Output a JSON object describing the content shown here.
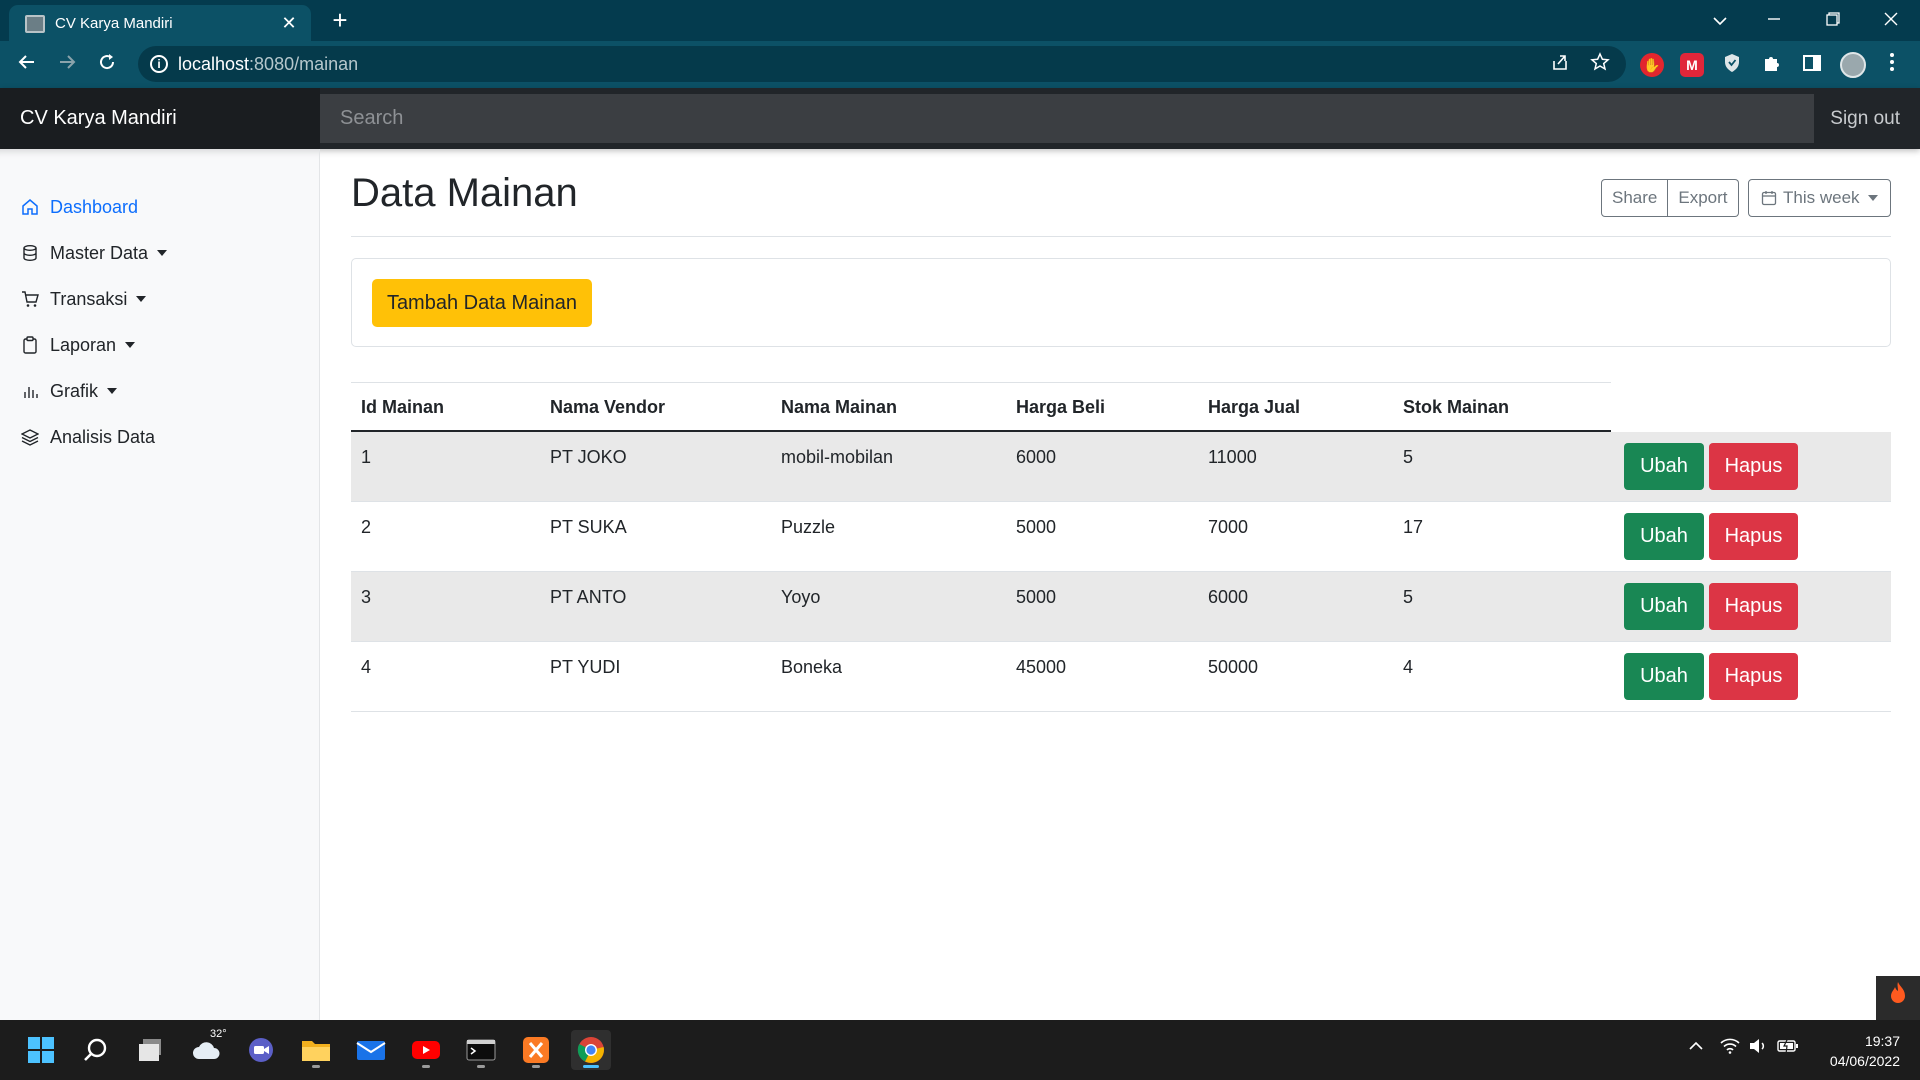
{
  "browser": {
    "tab_title": "CV Karya Mandiri",
    "tab_close": "✕",
    "new_tab": "+",
    "url_host": "localhost",
    "url_rest": ":8080/mainan"
  },
  "navbar": {
    "brand": "CV Karya Mandiri",
    "search_placeholder": "Search",
    "sign_out": "Sign out"
  },
  "sidebar": {
    "items": [
      {
        "label": "Dashboard",
        "icon": "home-icon",
        "active": true,
        "dropdown": false
      },
      {
        "label": "Master Data",
        "icon": "database-icon",
        "active": false,
        "dropdown": true
      },
      {
        "label": "Transaksi",
        "icon": "cart-icon",
        "active": false,
        "dropdown": true
      },
      {
        "label": "Laporan",
        "icon": "clipboard-icon",
        "active": false,
        "dropdown": true
      },
      {
        "label": "Grafik",
        "icon": "bar-chart-icon",
        "active": false,
        "dropdown": true
      },
      {
        "label": "Analisis Data",
        "icon": "layers-icon",
        "active": false,
        "dropdown": false
      }
    ]
  },
  "main": {
    "title": "Data Mainan",
    "share_label": "Share",
    "export_label": "Export",
    "week_label": "This week",
    "add_button": "Tambah Data Mainan"
  },
  "table": {
    "headers": [
      "Id Mainan",
      "Nama Vendor",
      "Nama Mainan",
      "Harga Beli",
      "Harga Jual",
      "Stok Mainan"
    ],
    "rows": [
      [
        "1",
        "PT JOKO",
        "mobil-mobilan",
        "6000",
        "11000",
        "5"
      ],
      [
        "2",
        "PT SUKA",
        "Puzzle",
        "5000",
        "7000",
        "17"
      ],
      [
        "3",
        "PT ANTO",
        "Yoyo",
        "5000",
        "6000",
        "5"
      ],
      [
        "4",
        "PT YUDI",
        "Boneka",
        "45000",
        "50000",
        "4"
      ]
    ],
    "edit_label": "Ubah",
    "delete_label": "Hapus"
  },
  "taskbar": {
    "weather_temp": "32°",
    "time": "19:37",
    "date": "04/06/2022"
  },
  "colors": {
    "accent": "#0d6efd",
    "warning": "#ffc107",
    "success": "#198754",
    "danger": "#dc3545",
    "navbar": "#212529",
    "chrome": "#0c5166"
  }
}
